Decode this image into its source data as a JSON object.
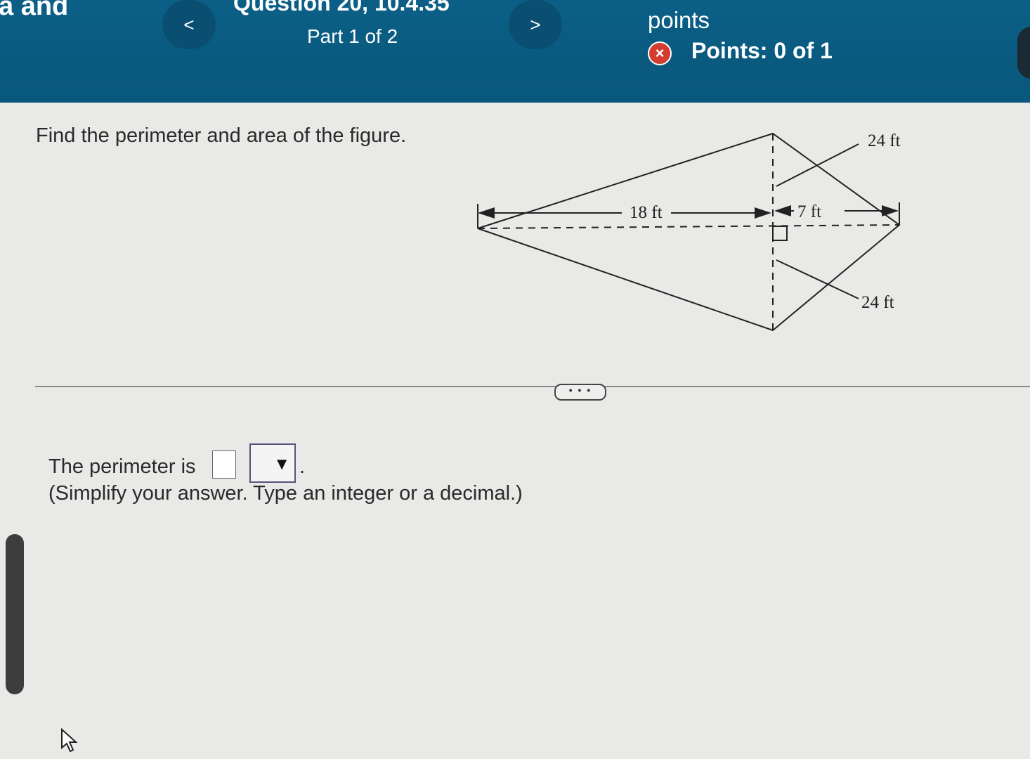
{
  "header": {
    "breadcrumb_fragment": "a and",
    "question_title": "Question 20, 10.4.35",
    "question_part": "Part 1 of 2",
    "prev_label": "<",
    "next_label": ">",
    "points_label": "points",
    "points_status_icon": "x-circle-icon",
    "points_score": "Points: 0 of 1",
    "colors": {
      "header_bg": "#0b5f86",
      "status_icon": "#d33c30"
    }
  },
  "question": {
    "prompt": "Find the perimeter and area of the figure.",
    "figure": {
      "label_top": "24 ft",
      "label_left": "18 ft",
      "label_right": "7 ft",
      "label_bottom": "24 ft"
    }
  },
  "more_button_label": "• • •",
  "answer": {
    "label": "The perimeter is",
    "input_value": "",
    "unit_select_value": "",
    "period": ".",
    "instructions": "(Simplify your answer. Type an integer or a decimal.)"
  }
}
